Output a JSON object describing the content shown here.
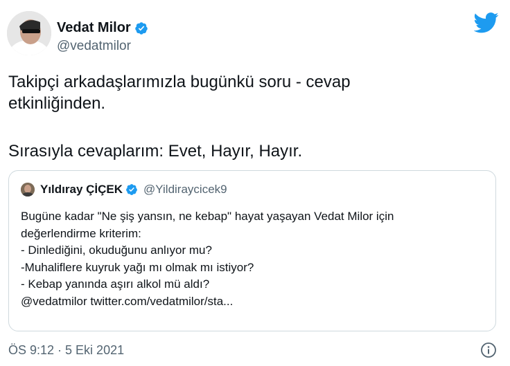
{
  "author": {
    "name": "Vedat Milor",
    "handle": "@vedatmilor",
    "verified": true,
    "avatar_icon": "profile-photo"
  },
  "brand": {
    "icon": "twitter-bird-icon",
    "color": "#1d9bf0"
  },
  "tweet": {
    "text_line1": "Takipçi arkadaşlarımızla bugünkü soru - cevap",
    "text_line2": "etkinliğinden.",
    "text_para2": "Sırasıyla cevaplarım: Evet, Hayır, Hayır."
  },
  "quoted_tweet": {
    "author_name": "Yıldıray ÇİÇEK",
    "author_handle": "@Yildiraycicek9",
    "verified": true,
    "lines": [
      "Bugüne kadar \"Ne şiş yansın, ne kebap\" hayat yaşayan Vedat Milor için",
      "değerlendirme kriterim:",
      "- Dinlediğini, okuduğunu anlıyor mu?",
      "-Muhaliflere kuyruk yağı mı olmak mı istiyor?",
      "- Kebap yanında aşırı alkol mü aldı?",
      "@vedatmilor twitter.com/vedatmilor/sta..."
    ]
  },
  "timestamp": "ÖS 9:12 · 5 Eki 2021",
  "colors": {
    "secondary_text": "#536471",
    "border": "#cfd9de",
    "verified": "#1d9bf0"
  }
}
